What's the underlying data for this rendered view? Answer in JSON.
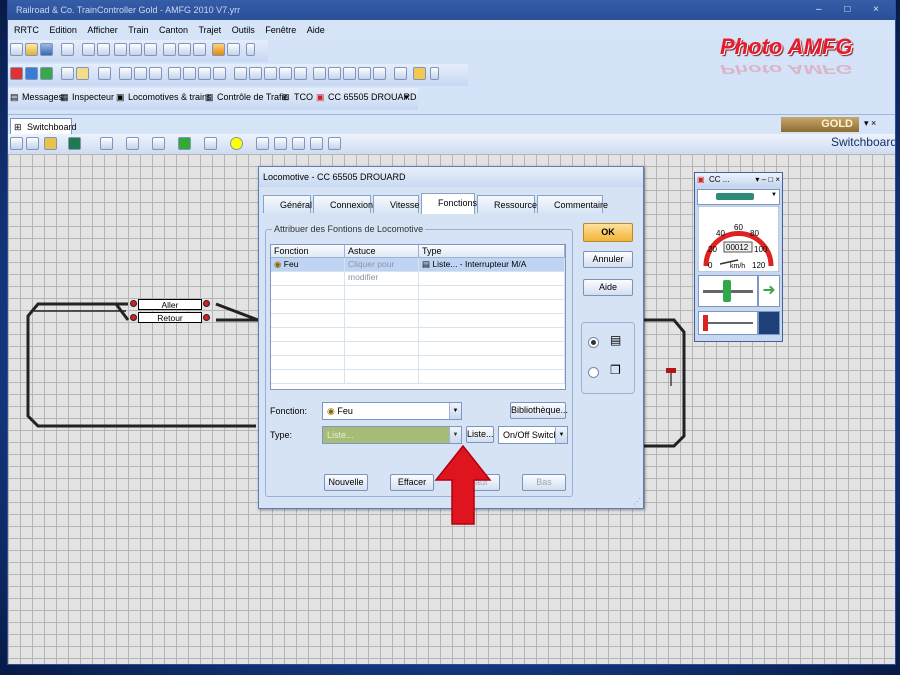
{
  "window": {
    "title": "Railroad & Co. TrainController Gold - AMFG 2010 V7.yrr",
    "controls": "– □ ×"
  },
  "menu": [
    "RRTC",
    "Edition",
    "Afficher",
    "Train",
    "Canton",
    "Trajet",
    "Outils",
    "Fenêtre",
    "Aide"
  ],
  "watermark": "Photo AMFG",
  "toolbar3": {
    "messages": "Messages",
    "inspecteur": "Inspecteur",
    "locomotives": "Locomotives & trains",
    "controle": "Contrôle de Trafic",
    "tco": "TCO",
    "loco": "CC 65505 DROUARD"
  },
  "doc_tab": {
    "label": "Switchboard",
    "badge": "GOLD",
    "controls": "▾ × "
  },
  "switchboard_label": "Switchboard",
  "routes": {
    "aller": "Aller",
    "retour": "Retour"
  },
  "dialog": {
    "title": "Locomotive - CC 65505 DROUARD",
    "tabs": [
      "Général",
      "Connexion",
      "Vitesse",
      "Fonctions",
      "Ressources",
      "Commentaire"
    ],
    "active_tab": "Fonctions",
    "group_label": "Attribuer des Fontions de Locomotive",
    "columns": [
      "Fonction",
      "Astuce",
      "Type"
    ],
    "rows": [
      {
        "fonction": "Feu",
        "astuce": "Cliquer pour modifier",
        "type": "Liste... - Interrupteur M/A"
      }
    ],
    "fonction_label": "Fonction:",
    "fonction_value": "Feu",
    "bibliotheque": "Bibliothèque...",
    "type_label": "Type:",
    "type_value": "Liste...",
    "liste_button": "Liste...",
    "switch_value": "On/Off Switch",
    "buttons": {
      "nouvelle": "Nouvelle",
      "effacer": "Effacer",
      "haut": "Haut",
      "bas": "Bas",
      "ok": "OK",
      "annuler": "Annuler",
      "aide": "Aide"
    }
  },
  "cab": {
    "title": "CC ...",
    "controls": "▾ – □ ×",
    "speed_display": "00012",
    "speed_unit": "km/h",
    "gauge_ticks": [
      "20",
      "40",
      "60",
      "80",
      "100",
      "120",
      "0"
    ]
  },
  "colors": {
    "arrow": "#e0141e",
    "ok_button": "#f2b43a",
    "grid_bg": "#e3e3e3"
  }
}
